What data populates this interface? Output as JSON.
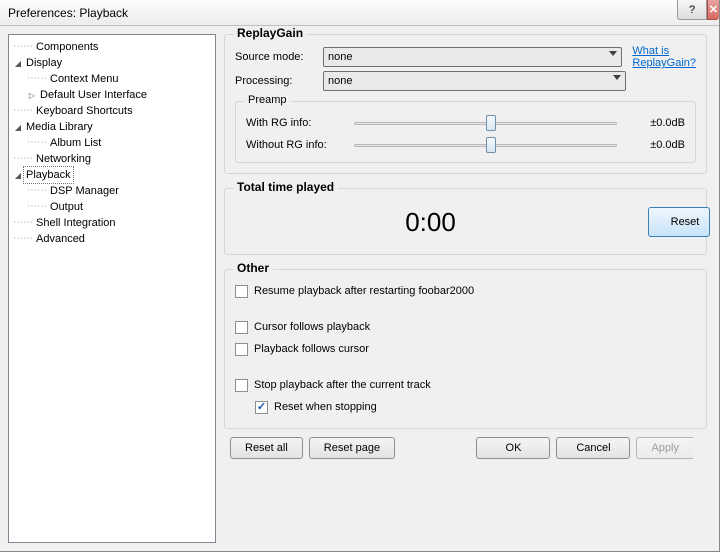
{
  "window": {
    "title": "Preferences: Playback"
  },
  "tree": {
    "components": "Components",
    "display": "Display",
    "context_menu": "Context Menu",
    "default_ui": "Default User Interface",
    "keyboard_shortcuts": "Keyboard Shortcuts",
    "media_library": "Media Library",
    "album_list": "Album List",
    "networking": "Networking",
    "playback": "Playback",
    "dsp_manager": "DSP Manager",
    "output": "Output",
    "shell_integration": "Shell Integration",
    "advanced": "Advanced"
  },
  "replaygain": {
    "legend": "ReplayGain",
    "source_label": "Source mode:",
    "source_value": "none",
    "processing_label": "Processing:",
    "processing_value": "none",
    "help_link1": "What is",
    "help_link2": "ReplayGain?",
    "preamp": {
      "legend": "Preamp",
      "with_label": "With RG info:",
      "with_value": "±0.0dB",
      "without_label": "Without RG info:",
      "without_value": "±0.0dB"
    }
  },
  "total_time": {
    "legend": "Total time played",
    "value": "0:00",
    "reset": "Reset"
  },
  "other": {
    "legend": "Other",
    "resume": "Resume playback after restarting foobar2000",
    "cursor_follows": "Cursor follows playback",
    "playback_follows": "Playback follows cursor",
    "stop_after": "Stop playback after the current track",
    "reset_when_stopping": "Reset when stopping"
  },
  "buttons": {
    "reset_all": "Reset all",
    "reset_page": "Reset page",
    "ok": "OK",
    "cancel": "Cancel",
    "apply": "Apply"
  }
}
